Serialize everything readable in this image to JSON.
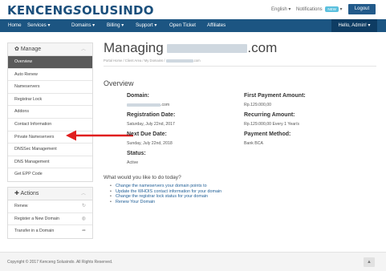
{
  "header": {
    "logo_text": "KENCENG",
    "logo_text_2": "OLUSINDO",
    "logo_s": "S",
    "language": "English ▾",
    "notifications_label": "Notifications",
    "notifications_badge": "NEW",
    "notifications_caret": "▾",
    "logout": "Logout"
  },
  "nav": {
    "items": [
      "Home",
      "Services ▾",
      "Domains ▾",
      "Billing ▾",
      "Support ▾",
      "Open Ticket",
      "Affiliates"
    ],
    "hello": "Hello, Admin! ▾"
  },
  "sidebar": {
    "manage_title": "Manage",
    "manage_items": [
      "Overview",
      "Auto Renew",
      "Nameservers",
      "Registrar Lock",
      "Addons",
      "Contact Information",
      "Private Nameservers",
      "DNSSec Management",
      "DNS Management",
      "Get EPP Code"
    ],
    "actions_title": "Actions",
    "actions_items": [
      "Renew",
      "Register a New Domain",
      "Transfer in a Domain"
    ]
  },
  "main": {
    "title_prefix": "Managing",
    "title_suffix": ".com",
    "breadcrumb_1": "Portal Home",
    "breadcrumb_2": "Client Area",
    "breadcrumb_3": "My Domains",
    "breadcrumb_4": ".com",
    "breadcrumb_sep": "/",
    "overview_title": "Overview",
    "domain_label": "Domain:",
    "domain_value_suffix": ".com",
    "registration_label": "Registration Date:",
    "registration_value": "Saturday, July 22nd, 2017",
    "next_due_label": "Next Due Date:",
    "next_due_value": "Sunday, July 22nd, 2018",
    "status_label": "Status:",
    "status_value": "Active",
    "first_payment_label": "First Payment Amount:",
    "first_payment_value": "Rp.129.000,00",
    "recurring_label": "Recurring Amount:",
    "recurring_value": "Rp.129.000,00 Every 1 Year/s",
    "payment_method_label": "Payment Method:",
    "payment_method_value": "Bank BCA",
    "todo_title": "What would you like to do today?",
    "todo_items": [
      "Change the nameservers your domain points to",
      "Update the WHOIS contact information for your domain",
      "Change the registrar lock status for your domain",
      "Renew Your Domain"
    ]
  },
  "footer": {
    "copyright": "Copyright © 2017 Kenceng Solusindo. All Rights Reserved.",
    "to_top": "▲"
  },
  "colors": {
    "brand": "#1a4f7c",
    "nav_bg": "#1c5582",
    "active_menu": "#5a5a5a",
    "link": "#1f5e96",
    "arrow": "#e01e1e"
  },
  "icons": {
    "manage": "gear-icon",
    "actions": "plus-icon",
    "renew": "refresh-icon",
    "register": "globe-icon",
    "transfer": "share-arrow-icon",
    "annotation": "red-arrow-icon"
  }
}
